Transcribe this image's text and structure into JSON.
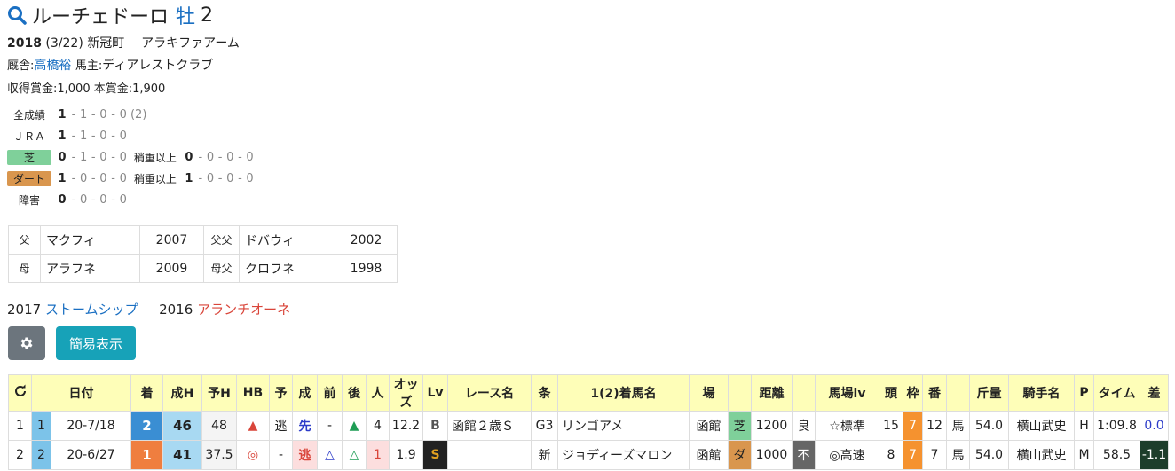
{
  "horse": {
    "name": "ルーチェドーロ",
    "sex": "牡",
    "age": "2"
  },
  "birth": {
    "year": "2018",
    "date": "(3/22)",
    "place": "新冠町",
    "breeder": "アラキファアーム"
  },
  "stable": {
    "label": "厩舎:",
    "trainer": "高橋裕",
    "owner_label": "馬主:",
    "owner": "ディアレストクラブ"
  },
  "prize": {
    "text": "収得賞金:1,000 本賞金:1,900"
  },
  "records": [
    {
      "label": "全成績",
      "type": "plain",
      "w": "1",
      "s": "1",
      "t": "0",
      "o": "0",
      "extra": "(2)"
    },
    {
      "label": "ＪＲＡ",
      "type": "plain",
      "w": "1",
      "s": "1",
      "t": "0",
      "o": "0"
    },
    {
      "label": "芝",
      "type": "turf",
      "w": "0",
      "s": "1",
      "t": "0",
      "o": "0",
      "heavy_label": "稍重以上",
      "hw": "0",
      "hs": "0",
      "ht": "0",
      "ho": "0"
    },
    {
      "label": "ダート",
      "type": "dirt",
      "w": "1",
      "s": "0",
      "t": "0",
      "o": "0",
      "heavy_label": "稍重以上",
      "hw": "1",
      "hs": "0",
      "ht": "0",
      "ho": "0"
    },
    {
      "label": "障害",
      "type": "plain",
      "w": "0",
      "s": "0",
      "t": "0",
      "o": "0"
    }
  ],
  "pedigree": {
    "sire_label": "父",
    "sire": "マクフィ",
    "sire_year": "2007",
    "ss_label": "父父",
    "ss": "ドバウィ",
    "ss_year": "2002",
    "dam_label": "母",
    "dam": "アラフネ",
    "dam_year": "2009",
    "ds_label": "母父",
    "ds": "クロフネ",
    "ds_year": "1998"
  },
  "siblings": [
    {
      "year": "2017",
      "name": "ストームシップ"
    },
    {
      "year": "2016",
      "name": "アランチオーネ"
    }
  ],
  "buttons": {
    "simple": "簡易表示"
  },
  "table": {
    "headers": [
      "",
      "日付",
      "着",
      "成H",
      "予H",
      "HB",
      "予",
      "成",
      "前",
      "後",
      "人",
      "オッズ",
      "Lv",
      "レース名",
      "条",
      "1(2)着馬名",
      "場",
      "",
      "距離",
      "",
      "馬場lv",
      "頭",
      "枠",
      "番",
      "",
      "斤量",
      "騎手名",
      "P",
      "タイム",
      "差"
    ],
    "rows": [
      {
        "no": "1",
        "num": "1",
        "date": "20-7/18",
        "rank": "2",
        "seiH": "46",
        "yoH": "48",
        "hb": "▲",
        "yo": "逃",
        "sei": "先",
        "mae": "-",
        "ato": "▲",
        "pop": "4",
        "odds": "12.2",
        "lv": "B",
        "race": "函館２歳Ｓ",
        "cls": "G3",
        "winner": "リンゴアメ",
        "place": "函館",
        "surf": "芝",
        "dist": "1200",
        "cond": "良",
        "baba": "☆標準",
        "heads": "15",
        "waku": "7",
        "ban": "12",
        "sex": "馬",
        "kin": "54.0",
        "jockey": "横山武史",
        "pos": "H",
        "time": "1:09.8",
        "diff": "0.0"
      },
      {
        "no": "2",
        "num": "2",
        "date": "20-6/27",
        "rank": "1",
        "seiH": "41",
        "yoH": "37.5",
        "hb": "◎",
        "yo": "-",
        "sei": "逃",
        "mae": "△",
        "ato": "△",
        "pop": "1",
        "odds": "1.9",
        "lv": "S",
        "race": "",
        "cls": "新",
        "winner": "ジョディーズマロン",
        "place": "函館",
        "surf": "ダ",
        "dist": "1000",
        "cond": "不",
        "baba": "◎高速",
        "heads": "8",
        "waku": "7",
        "ban": "7",
        "sex": "馬",
        "kin": "54.0",
        "jockey": "横山武史",
        "pos": "M",
        "time": "58.5",
        "diff": "-1.1"
      }
    ]
  }
}
